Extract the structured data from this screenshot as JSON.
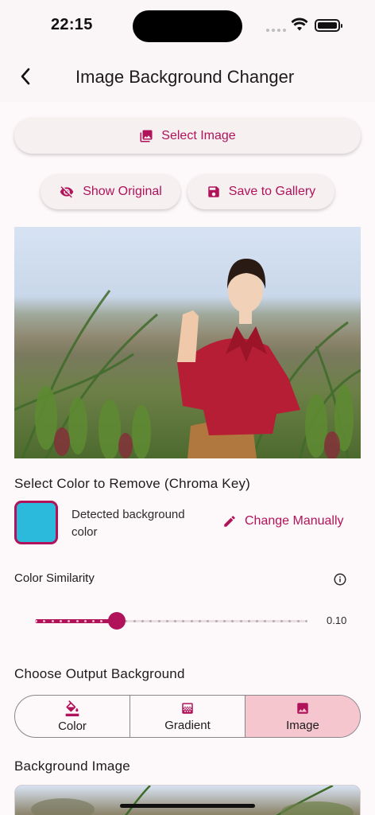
{
  "status": {
    "time": "22:15"
  },
  "appbar": {
    "title": "Image Background Changer"
  },
  "actions": {
    "select_image": "Select Image",
    "show_original": "Show Original",
    "save_to_gallery": "Save to Gallery"
  },
  "chroma": {
    "heading": "Select Color to Remove (Chroma Key)",
    "detected_label": "Detected background color",
    "detected_color": "#2bbadb",
    "change_manually": "Change Manually"
  },
  "similarity": {
    "label": "Color Similarity",
    "value": 0.1,
    "value_text": "0.10",
    "min": 0,
    "max": 0.33
  },
  "output": {
    "heading": "Choose Output Background",
    "options": [
      {
        "label": "Color",
        "icon": "format-color-fill-icon",
        "selected": false
      },
      {
        "label": "Gradient",
        "icon": "gradient-icon",
        "selected": false
      },
      {
        "label": "Image",
        "icon": "image-icon",
        "selected": true
      }
    ]
  },
  "background_image": {
    "heading": "Background Image"
  },
  "colors": {
    "accent": "#b0135a",
    "selected_segment": "#f6c6cf",
    "surface": "#fdf8f9"
  }
}
